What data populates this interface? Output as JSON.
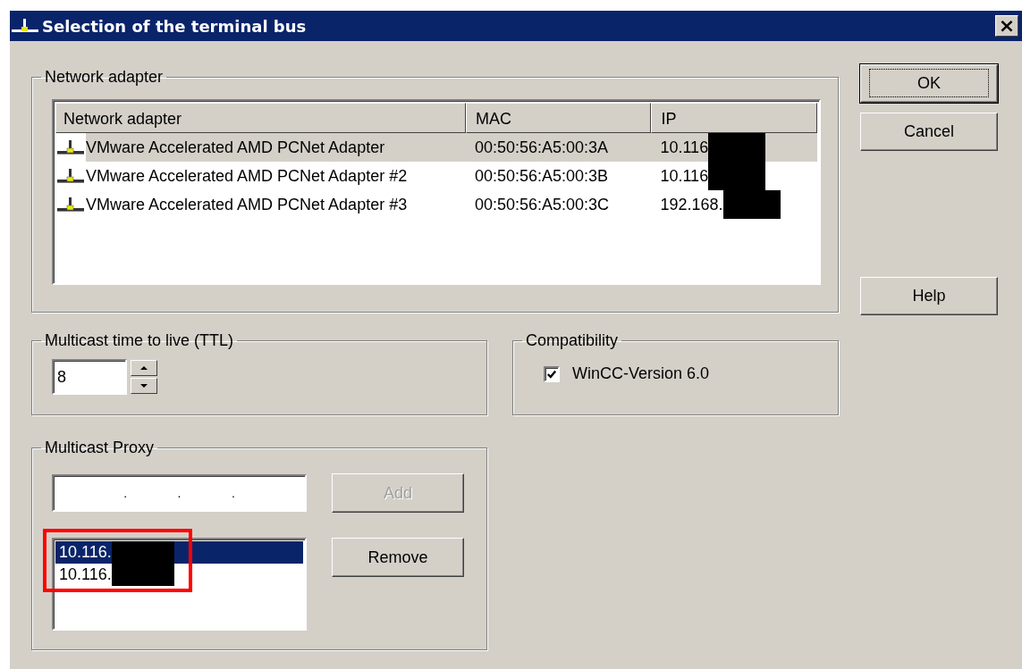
{
  "window": {
    "title": "Selection of the terminal bus",
    "close": "×"
  },
  "network_adapter": {
    "legend": "Network adapter",
    "columns": [
      "Network adapter",
      "MAC",
      "IP"
    ],
    "rows": [
      {
        "name": "VMware Accelerated AMD PCNet Adapter",
        "mac": "00:50:56:A5:00:3A",
        "ip": "10.116",
        "redacted": true,
        "selected": true
      },
      {
        "name": "VMware Accelerated AMD PCNet Adapter #2",
        "mac": "00:50:56:A5:00:3B",
        "ip": "10.116",
        "redacted": true,
        "selected": false
      },
      {
        "name": "VMware Accelerated AMD PCNet Adapter #3",
        "mac": "00:50:56:A5:00:3C",
        "ip": "192.168.",
        "redacted": true,
        "selected": false
      }
    ]
  },
  "ttl": {
    "legend": "Multicast time to live (TTL)",
    "value": "8"
  },
  "compatibility": {
    "legend": "Compatibility",
    "checkbox": {
      "label": "WinCC-Version 6.0",
      "checked": true
    }
  },
  "proxy": {
    "legend": "Multicast Proxy",
    "ip_field_dots": [
      ".",
      ".",
      "."
    ],
    "add_button": {
      "label": "Add",
      "disabled": true
    },
    "remove_button": {
      "label": "Remove",
      "disabled": false
    },
    "highlight_frame": true,
    "items": [
      {
        "ip": "10.116.",
        "redacted": true,
        "selected": true
      },
      {
        "ip": "10.116.",
        "redacted": true,
        "selected": false
      }
    ]
  },
  "buttons": [
    {
      "label": "OK",
      "default": true
    },
    {
      "label": "Cancel",
      "default": false
    },
    {
      "label": "Help",
      "default": false
    }
  ]
}
